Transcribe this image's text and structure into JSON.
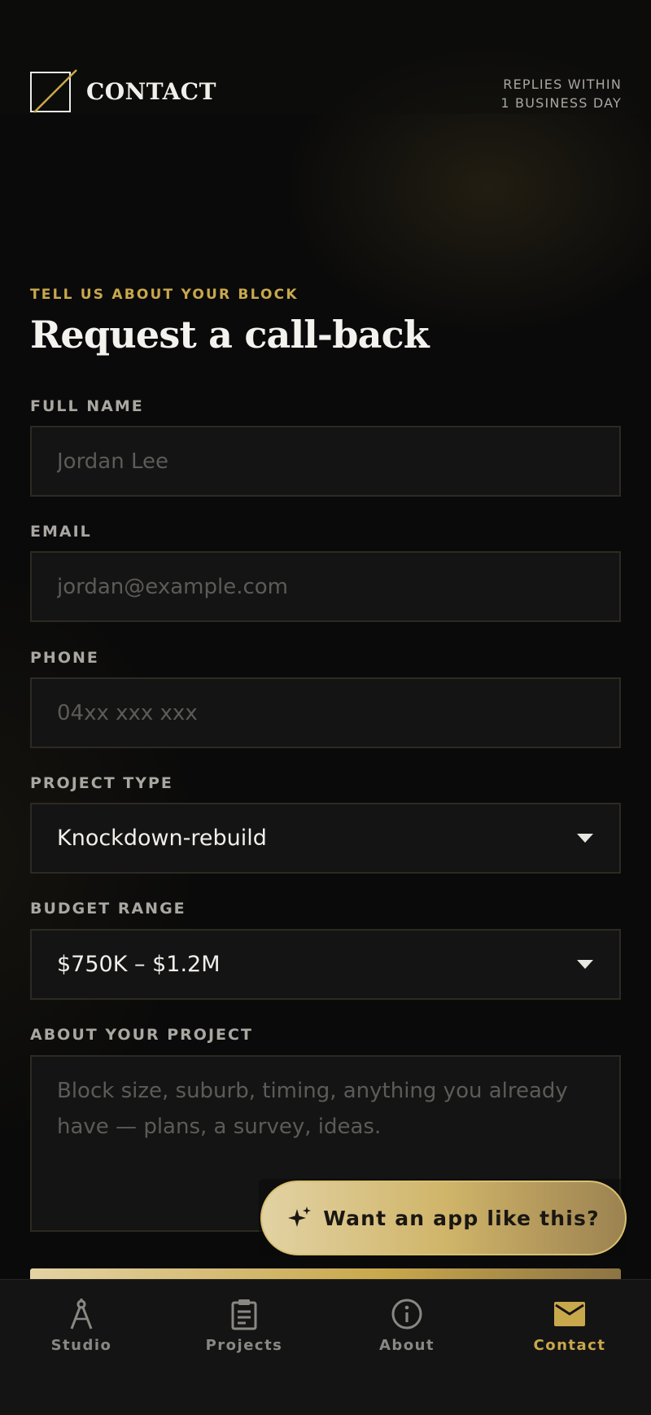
{
  "header": {
    "brand": "CONTACT",
    "replies_line1": "REPLIES WITHIN",
    "replies_line2": "1 BUSINESS DAY"
  },
  "intro": {
    "eyebrow": "TELL US ABOUT YOUR BLOCK",
    "title": "Request a call-back"
  },
  "form": {
    "full_name": {
      "label": "FULL NAME",
      "placeholder": "Jordan Lee",
      "value": ""
    },
    "email": {
      "label": "EMAIL",
      "placeholder": "jordan@example.com",
      "value": ""
    },
    "phone": {
      "label": "PHONE",
      "placeholder": "04xx xxx xxx",
      "value": ""
    },
    "project_type": {
      "label": "PROJECT TYPE",
      "value": "Knockdown-rebuild"
    },
    "budget_range": {
      "label": "BUDGET RANGE",
      "value": "$750K – $1.2M"
    },
    "about": {
      "label": "ABOUT YOUR PROJECT",
      "placeholder": "Block size, suburb, timing, anything you already have — plans, a survey, ideas."
    }
  },
  "fab": {
    "label": "Want an app like this?",
    "icon": "sparkle-icon"
  },
  "nav": {
    "items": [
      {
        "label": "Studio",
        "icon": "compass-icon",
        "active": false
      },
      {
        "label": "Projects",
        "icon": "clipboard-icon",
        "active": false
      },
      {
        "label": "About",
        "icon": "info-icon",
        "active": false
      },
      {
        "label": "Contact",
        "icon": "envelope-icon",
        "active": true
      }
    ]
  },
  "colors": {
    "accent": "#c9a84c",
    "background": "#0a0a0a",
    "field": "#141414",
    "muted": "#a9a7a1"
  }
}
